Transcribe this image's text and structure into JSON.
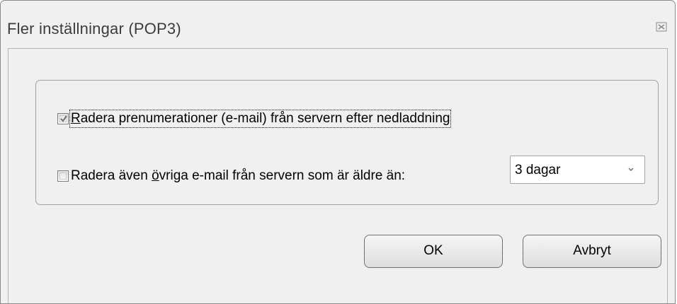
{
  "window": {
    "title": "Fler inställningar (POP3)",
    "close_icon": "close-icon"
  },
  "options": {
    "delete_subscriptions": {
      "checked": true,
      "label_first": "R",
      "label_rest": "adera prenumerationer (e-mail) från servern efter nedladdning"
    },
    "delete_other": {
      "checked": false,
      "label_before": "Radera även ",
      "label_underlined": "ö",
      "label_after": "vriga e-mail från servern som är äldre än:"
    },
    "age_select": {
      "value": "3 dagar",
      "icon": "dropdown-arrow-icon"
    }
  },
  "buttons": {
    "ok_label": "OK",
    "cancel_label": "Avbryt"
  }
}
